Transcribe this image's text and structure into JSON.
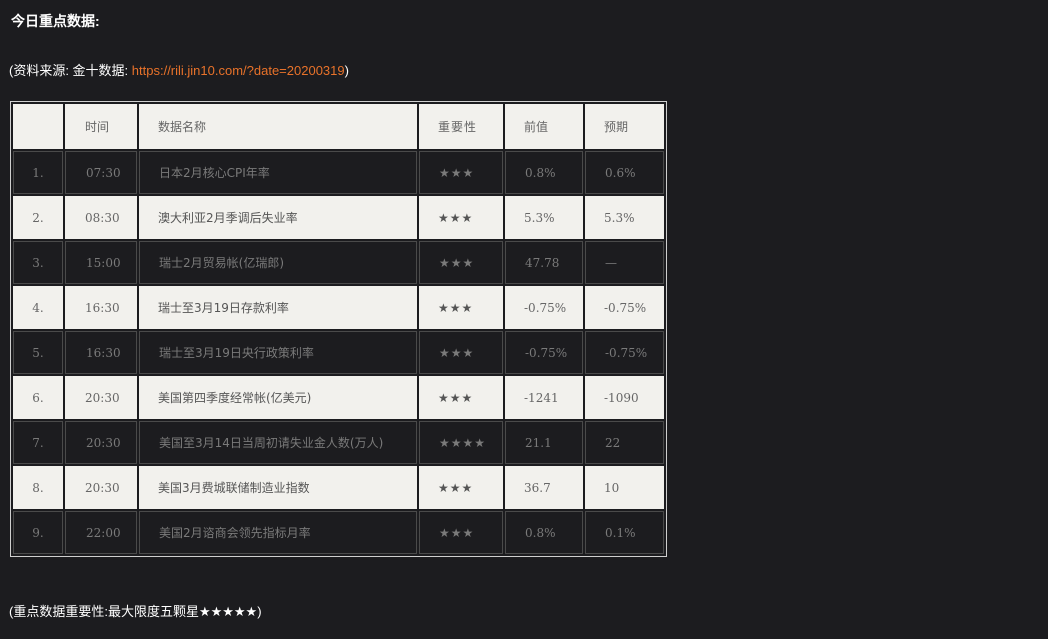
{
  "heading": "今日重点数据:",
  "source": {
    "prefix": "(资料来源: 金十数据: ",
    "link": "https://rili.jin10.com/?date=20200319",
    "suffix": ")"
  },
  "table": {
    "headers": [
      "",
      "时间",
      "数据名称",
      "重要性",
      "前值",
      "预期"
    ],
    "rows": [
      {
        "no": "1.",
        "time": "07:30",
        "name": "日本2月核心CPI年率",
        "importance": "★★★",
        "previous": "0.8%",
        "forecast": "0.6%"
      },
      {
        "no": "2.",
        "time": "08:30",
        "name": "澳大利亚2月季调后失业率",
        "importance": "★★★",
        "previous": "5.3%",
        "forecast": "5.3%"
      },
      {
        "no": "3.",
        "time": "15:00",
        "name": "瑞士2月贸易帐(亿瑞郎)",
        "importance": "★★★",
        "previous": "47.78",
        "forecast": "—"
      },
      {
        "no": "4.",
        "time": "16:30",
        "name": "瑞士至3月19日存款利率",
        "importance": "★★★",
        "previous": "-0.75%",
        "forecast": "-0.75%"
      },
      {
        "no": "5.",
        "time": "16:30",
        "name": "瑞士至3月19日央行政策利率",
        "importance": "★★★",
        "previous": "-0.75%",
        "forecast": "-0.75%"
      },
      {
        "no": "6.",
        "time": "20:30",
        "name": "美国第四季度经常帐(亿美元)",
        "importance": "★★★",
        "previous": "-1241",
        "forecast": "-1090"
      },
      {
        "no": "7.",
        "time": "20:30",
        "name": "美国至3月14日当周初请失业金人数(万人)",
        "importance": "★★★★",
        "previous": "21.1",
        "forecast": "22"
      },
      {
        "no": "8.",
        "time": "20:30",
        "name": "美国3月费城联储制造业指数",
        "importance": "★★★",
        "previous": "36.7",
        "forecast": "10"
      },
      {
        "no": "9.",
        "time": "22:00",
        "name": "美国2月谘商会领先指标月率",
        "importance": "★★★",
        "previous": "0.8%",
        "forecast": "0.1%"
      }
    ]
  },
  "footer": "(重点数据重要性:最大限度五颗星★★★★★)"
}
